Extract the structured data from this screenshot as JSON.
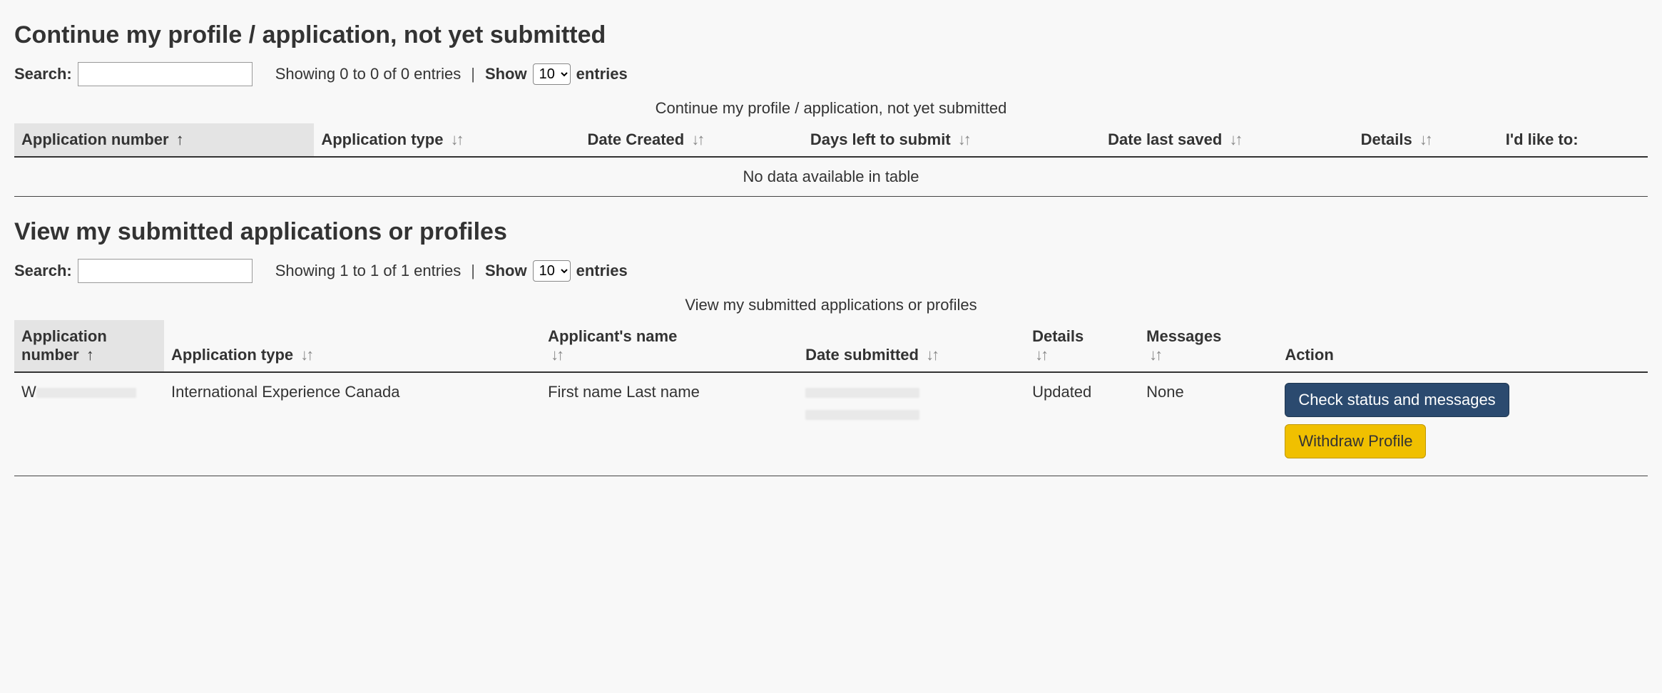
{
  "section1": {
    "heading": "Continue my profile / application, not yet submitted",
    "search_label": "Search:",
    "showing_text": "Showing 0 to 0 of 0 entries",
    "show_label": "Show",
    "entries_value": "10",
    "entries_suffix": "entries",
    "table_caption": "Continue my profile / application, not yet submitted",
    "columns": {
      "app_number": "Application number",
      "app_type": "Application type",
      "date_created": "Date Created",
      "days_left": "Days left to submit",
      "date_saved": "Date last saved",
      "details": "Details",
      "like_to": "I'd like to:"
    },
    "no_data": "No data available in table"
  },
  "section2": {
    "heading": "View my submitted applications or profiles",
    "search_label": "Search:",
    "showing_text": "Showing 1 to 1 of 1 entries",
    "show_label": "Show",
    "entries_value": "10",
    "entries_suffix": "entries",
    "table_caption": "View my submitted applications or profiles",
    "columns": {
      "app_number": "Application number",
      "app_type": "Application type",
      "applicant_name": "Applicant's name",
      "date_submitted": "Date submitted",
      "details": "Details",
      "messages": "Messages",
      "action": "Action"
    },
    "rows": [
      {
        "app_number": "W",
        "app_type": "International Experience Canada",
        "applicant_name": "First name Last name",
        "date_submitted": "",
        "details": "Updated",
        "messages": "None",
        "check_btn": "Check status and messages",
        "withdraw_btn": "Withdraw Profile"
      }
    ]
  }
}
